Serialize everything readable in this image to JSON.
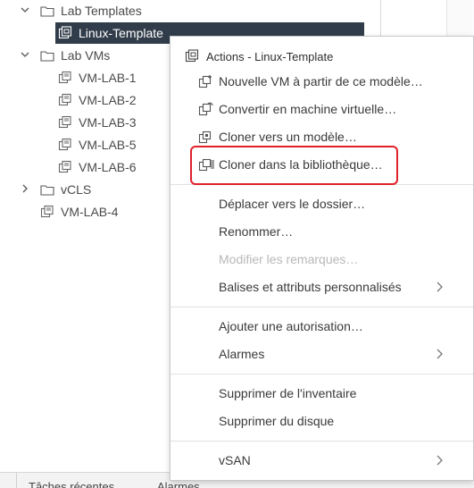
{
  "tree": {
    "items": [
      {
        "label": "Lab Templates",
        "icon": "folder-icon",
        "chevron": "expanded"
      },
      {
        "label": "Linux-Template",
        "icon": "vm-template-icon",
        "selected": true
      },
      {
        "label": "Lab VMs",
        "icon": "folder-icon",
        "chevron": "expanded"
      },
      {
        "label": "VM-LAB-1",
        "icon": "vm-icon"
      },
      {
        "label": "VM-LAB-2",
        "icon": "vm-icon"
      },
      {
        "label": "VM-LAB-3",
        "icon": "vm-icon"
      },
      {
        "label": "VM-LAB-5",
        "icon": "vm-icon"
      },
      {
        "label": "VM-LAB-6",
        "icon": "vm-icon"
      },
      {
        "label": "vCLS",
        "icon": "folder-icon",
        "chevron": "collapsed"
      },
      {
        "label": "VM-LAB-4",
        "icon": "vm-icon"
      }
    ]
  },
  "context_menu": {
    "title": "Actions - Linux-Template",
    "items": [
      {
        "label": "Nouvelle VM à partir de ce modèle…",
        "icon": "new-vm-from-template-icon"
      },
      {
        "label": "Convertir en machine virtuelle…",
        "icon": "convert-to-vm-icon"
      },
      {
        "label": "Cloner vers un modèle…",
        "icon": "clone-to-template-icon"
      },
      {
        "label": "Cloner dans la bibliothèque…",
        "icon": "clone-to-library-icon",
        "highlighted": true
      },
      {
        "label": "Déplacer vers le dossier…"
      },
      {
        "label": "Renommer…"
      },
      {
        "label": "Modifier les remarques…",
        "disabled": true
      },
      {
        "label": "Balises et attributs personnalisés",
        "submenu": true
      },
      {
        "label": "Ajouter une autorisation…"
      },
      {
        "label": "Alarmes",
        "submenu": true
      },
      {
        "label": "Supprimer de l'inventaire"
      },
      {
        "label": "Supprimer du disque"
      },
      {
        "label": "vSAN",
        "submenu": true
      }
    ]
  },
  "bottom_bar": {
    "tabs": [
      "Tâches récentes",
      "Alarmes"
    ]
  },
  "colors": {
    "selected_row_bg": "#313d4a",
    "highlight_border": "#e0202a",
    "disabled_text": "#b8b8b8"
  }
}
